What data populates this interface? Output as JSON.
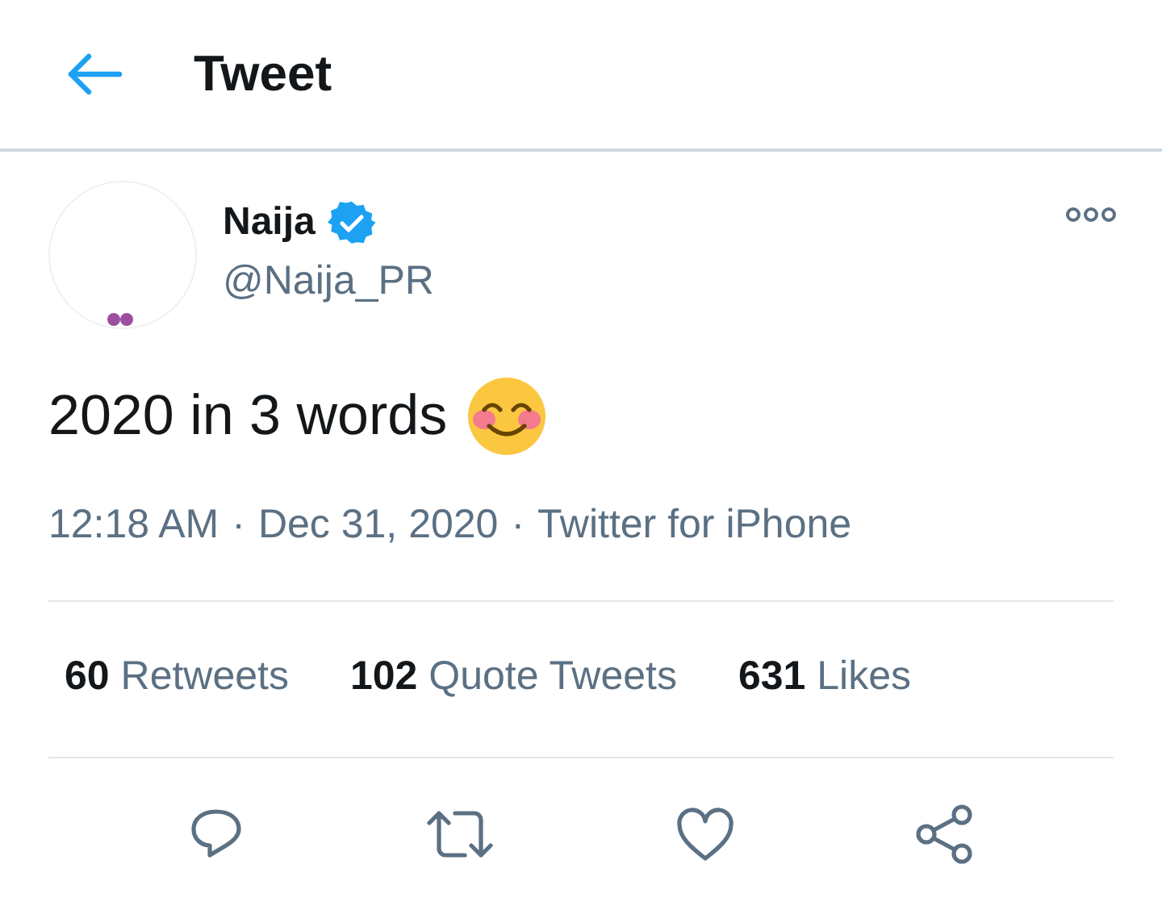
{
  "header": {
    "title": "Tweet"
  },
  "author": {
    "name": "Naija",
    "verified": true,
    "handle": "@Naija_PR"
  },
  "tweet": {
    "text": "2020 in 3 words"
  },
  "meta": {
    "time": "12:18 AM",
    "separator_1": "·",
    "date": "Dec 31, 2020",
    "separator_2": "·",
    "source": "Twitter for iPhone"
  },
  "stats": [
    {
      "count": "60",
      "label": "Retweets"
    },
    {
      "count": "102",
      "label": "Quote Tweets"
    },
    {
      "count": "631",
      "label": "Likes"
    }
  ]
}
